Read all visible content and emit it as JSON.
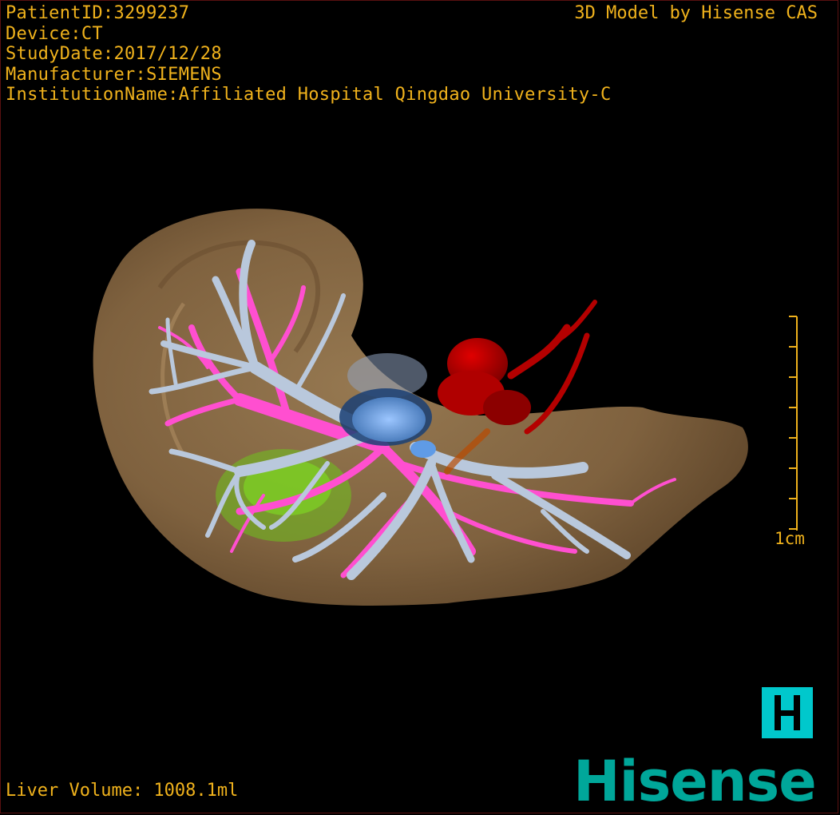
{
  "patient_info": {
    "patient_id": "PatientID:3299237",
    "device": "Device:CT",
    "study_date": "StudyDate:2017/12/28",
    "manufacturer": "Manufacturer:SIEMENS",
    "institution": "InstitutionName:Affiliated Hospital Qingdao University-C"
  },
  "credit": "3D Model by Hisense CAS",
  "scale_bar": {
    "label": "1cm"
  },
  "liver_volume": "Liver Volume: 1008.1ml",
  "brand": {
    "logo_text": "Hisense",
    "badge_letter": "H",
    "color": "#00a79a",
    "badge_color": "#00c8cc"
  },
  "model_colors": {
    "liver": "#8a6a44",
    "portal_vein": "#b9c8dc",
    "hepatic_vein": "#ff4fd0",
    "artery": "#c40000",
    "lesion": "#6fc21e",
    "gallbladder": "#6ea8f0"
  },
  "overlay_text_color": "#f0b21c"
}
